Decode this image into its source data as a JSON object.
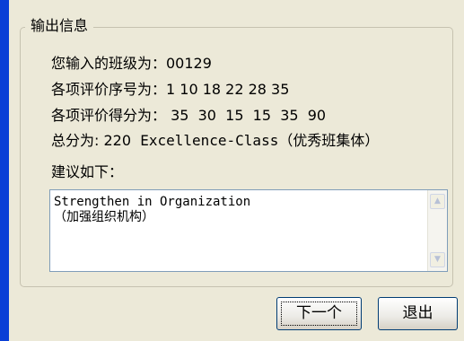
{
  "group": {
    "title": "输出信息"
  },
  "info": {
    "class_line": "您输入的班级为：00129",
    "serial_line": "各项评价序号为：1 10 18 22 28 35",
    "scores_line": "各项评价得分为： 35  30  15  15  35  90",
    "total_line_prefix": "总分为: 220  ",
    "total_line_suffix": "Excellence-Class（优秀班集体）"
  },
  "advice": {
    "label": "建议如下：",
    "text_line1": "Strengthen in Organization",
    "text_line2": "（加强组织机构）"
  },
  "buttons": {
    "next_label": "下一个",
    "exit_label": "退出"
  },
  "icons": {
    "scroll_up": "scroll-up-arrow",
    "scroll_down": "scroll-down-arrow"
  },
  "colors": {
    "window_edge": "#0a3fd6",
    "dialog_bg": "#ece9d8",
    "button_border": "#003c74"
  }
}
